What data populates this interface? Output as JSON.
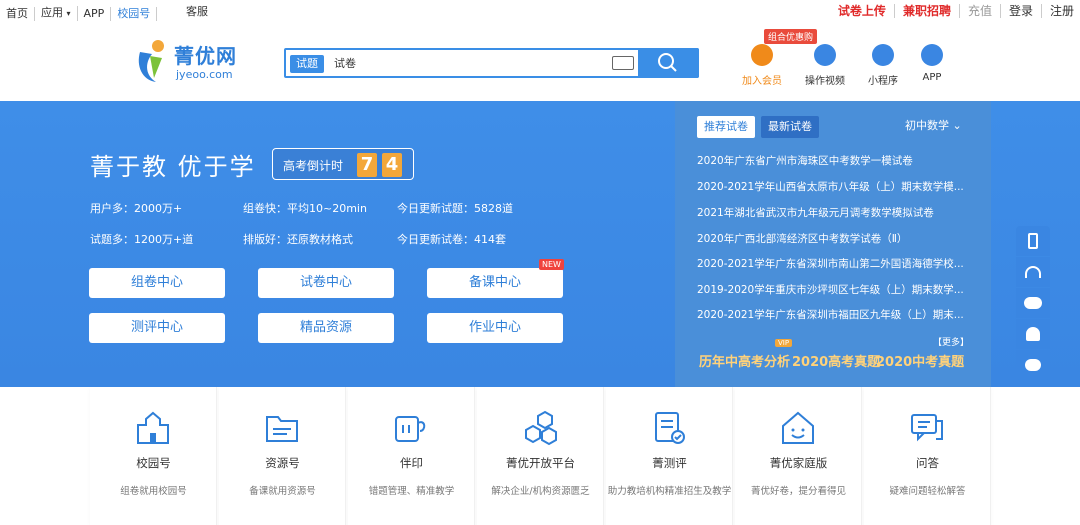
{
  "topbar": {
    "left": [
      "首页",
      "应用",
      "APP",
      "校园号"
    ],
    "kefu": "客服",
    "right": [
      "试卷上传",
      "兼职招聘",
      "充值",
      "登录",
      "注册"
    ]
  },
  "logo": {
    "cn": "菁优网",
    "en": "jyeoo.com"
  },
  "search": {
    "tab_active": "试题",
    "tab_other": "试卷",
    "placeholder": ""
  },
  "quick": {
    "promo": "组合优惠购",
    "items": [
      "加入会员",
      "操作视频",
      "小程序",
      "APP"
    ]
  },
  "hero": {
    "slogan": "菁于教 优于学",
    "countdown_label": "高考倒计时",
    "countdown_digits": [
      "7",
      "4"
    ],
    "stats": [
      "用户多：2000万+",
      "组卷快：平均10~20min",
      "今日更新试题：5828道",
      "试题多：1200万+道",
      "排版好：还原教材格式",
      "今日更新试卷：414套"
    ],
    "buttons": [
      "组卷中心",
      "试卷中心",
      "备课中心",
      "测评中心",
      "精品资源",
      "作业中心"
    ],
    "new_badge": "NEW"
  },
  "panel": {
    "tabs": [
      "推荐试卷",
      "最新试卷"
    ],
    "subject": "初中数学",
    "papers": [
      "2020年广东省广州市海珠区中考数学一模试卷",
      "2020-2021学年山西省太原市八年级（上）期末数学模...",
      "2021年湖北省武汉市九年级元月调考数学模拟试卷",
      "2020年广西北部湾经济区中考数学试卷（Ⅱ）",
      "2020-2021学年广东省深圳市南山第二外国语海德学校...",
      "2019-2020学年重庆市沙坪坝区七年级（上）期末数学...",
      "2020-2021学年广东省深圳市福田区九年级（上）期末..."
    ],
    "more": "【更多】",
    "vip": "VIP",
    "exams": [
      "历年中高考分析",
      "2020高考真题",
      "2020中考真题"
    ]
  },
  "cards": [
    {
      "title": "校园号",
      "sub": "组卷就用校园号"
    },
    {
      "title": "资源号",
      "sub": "备课就用资源号"
    },
    {
      "title": "伴印",
      "sub": "错题管理、精准教学"
    },
    {
      "title": "菁优开放平台",
      "sub": "解决企业/机构资源匮乏"
    },
    {
      "title": "菁测评",
      "sub": "助力教培机构精准招生及教学"
    },
    {
      "title": "菁优家庭版",
      "sub": "菁优好卷，提分看得见"
    },
    {
      "title": "问答",
      "sub": "疑难问题轻松解答"
    }
  ],
  "colors": {
    "accent": "#3a8ee6",
    "hero": "#3f8ee8",
    "red": "#e02a2a",
    "orange": "#f3a73a"
  }
}
